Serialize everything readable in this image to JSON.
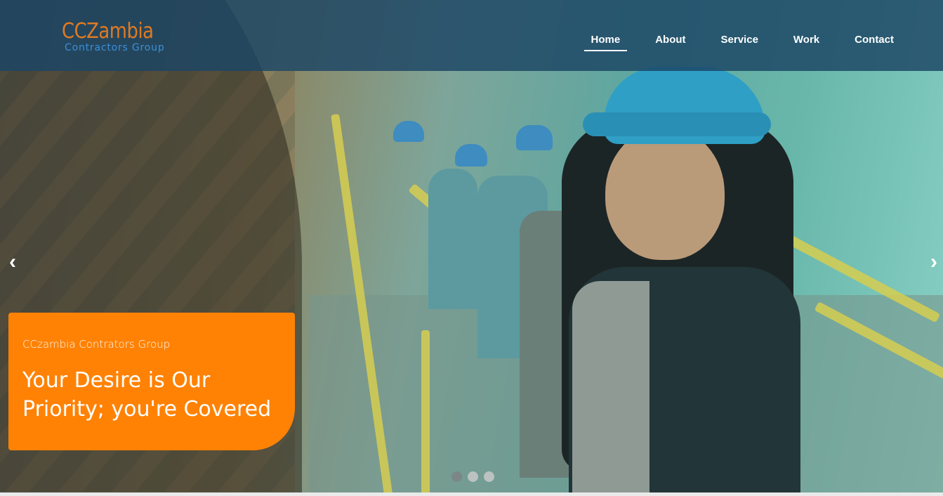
{
  "brand": {
    "name": "CCZambia",
    "tagline": "Contractors Group",
    "name_color": "#e07a22",
    "tagline_color": "#3a8fd8"
  },
  "nav": {
    "items": [
      {
        "label": "Home",
        "active": true
      },
      {
        "label": "About"
      },
      {
        "label": "Service"
      },
      {
        "label": "Work"
      },
      {
        "label": "Contact"
      }
    ]
  },
  "slider": {
    "prev_icon": "chevron-left-icon",
    "next_icon": "chevron-right-icon",
    "prev_glyph": "‹",
    "next_glyph": "›",
    "caption": {
      "subtitle": "CCzambia Contrators Group",
      "title": "Your Desire is Our Priority; you're Covered",
      "background": "#ff8205"
    },
    "slide_count": 3,
    "active_slide": 1
  }
}
